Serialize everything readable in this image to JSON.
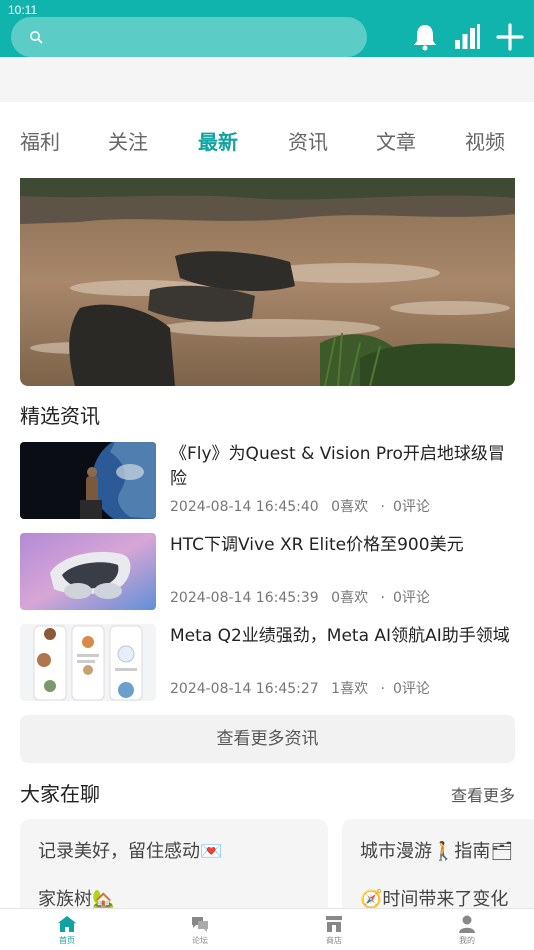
{
  "status_bar": {
    "time": "10:11"
  },
  "header": {
    "search_icon": "search-icon",
    "icons": [
      "bell-icon",
      "chart-icon",
      "plus-icon"
    ]
  },
  "tabs": [
    {
      "label": "福利"
    },
    {
      "label": "关注"
    },
    {
      "label": "最新",
      "active": true
    },
    {
      "label": "资讯"
    },
    {
      "label": "文章"
    },
    {
      "label": "视频"
    }
  ],
  "featured_news": {
    "title": "精选资讯",
    "items": [
      {
        "title": "《Fly》为Quest & Vision Pro开启地球级冒险",
        "time": "2024-08-14 16:45:40",
        "likes": "0喜欢",
        "comments": "0评论"
      },
      {
        "title": "HTC下调Vive XR Elite价格至900美元",
        "time": "2024-08-14 16:45:39",
        "likes": "0喜欢",
        "comments": "0评论"
      },
      {
        "title": "Meta Q2业绩强劲，Meta AI领航AI助手领域",
        "time": "2024-08-14 16:45:27",
        "likes": "1喜欢",
        "comments": "0评论"
      }
    ],
    "more_button": "查看更多资讯"
  },
  "discussion": {
    "title": "大家在聊",
    "see_more": "查看更多",
    "cards": [
      {
        "line1": "记录美好，留住感动💌",
        "line2": "家族树🏡"
      },
      {
        "line1": "城市漫游🚶指南🗂",
        "line2": "🧭时间带来了变化"
      }
    ]
  },
  "bottom_nav": [
    {
      "label": "首页",
      "icon": "home-icon",
      "active": true
    },
    {
      "label": "论坛",
      "icon": "forum-icon"
    },
    {
      "label": "商店",
      "icon": "shop-icon"
    },
    {
      "label": "我的",
      "icon": "profile-icon"
    }
  ],
  "colors": {
    "accent": "#11b3ad",
    "active_tab": "#11a3a0"
  }
}
